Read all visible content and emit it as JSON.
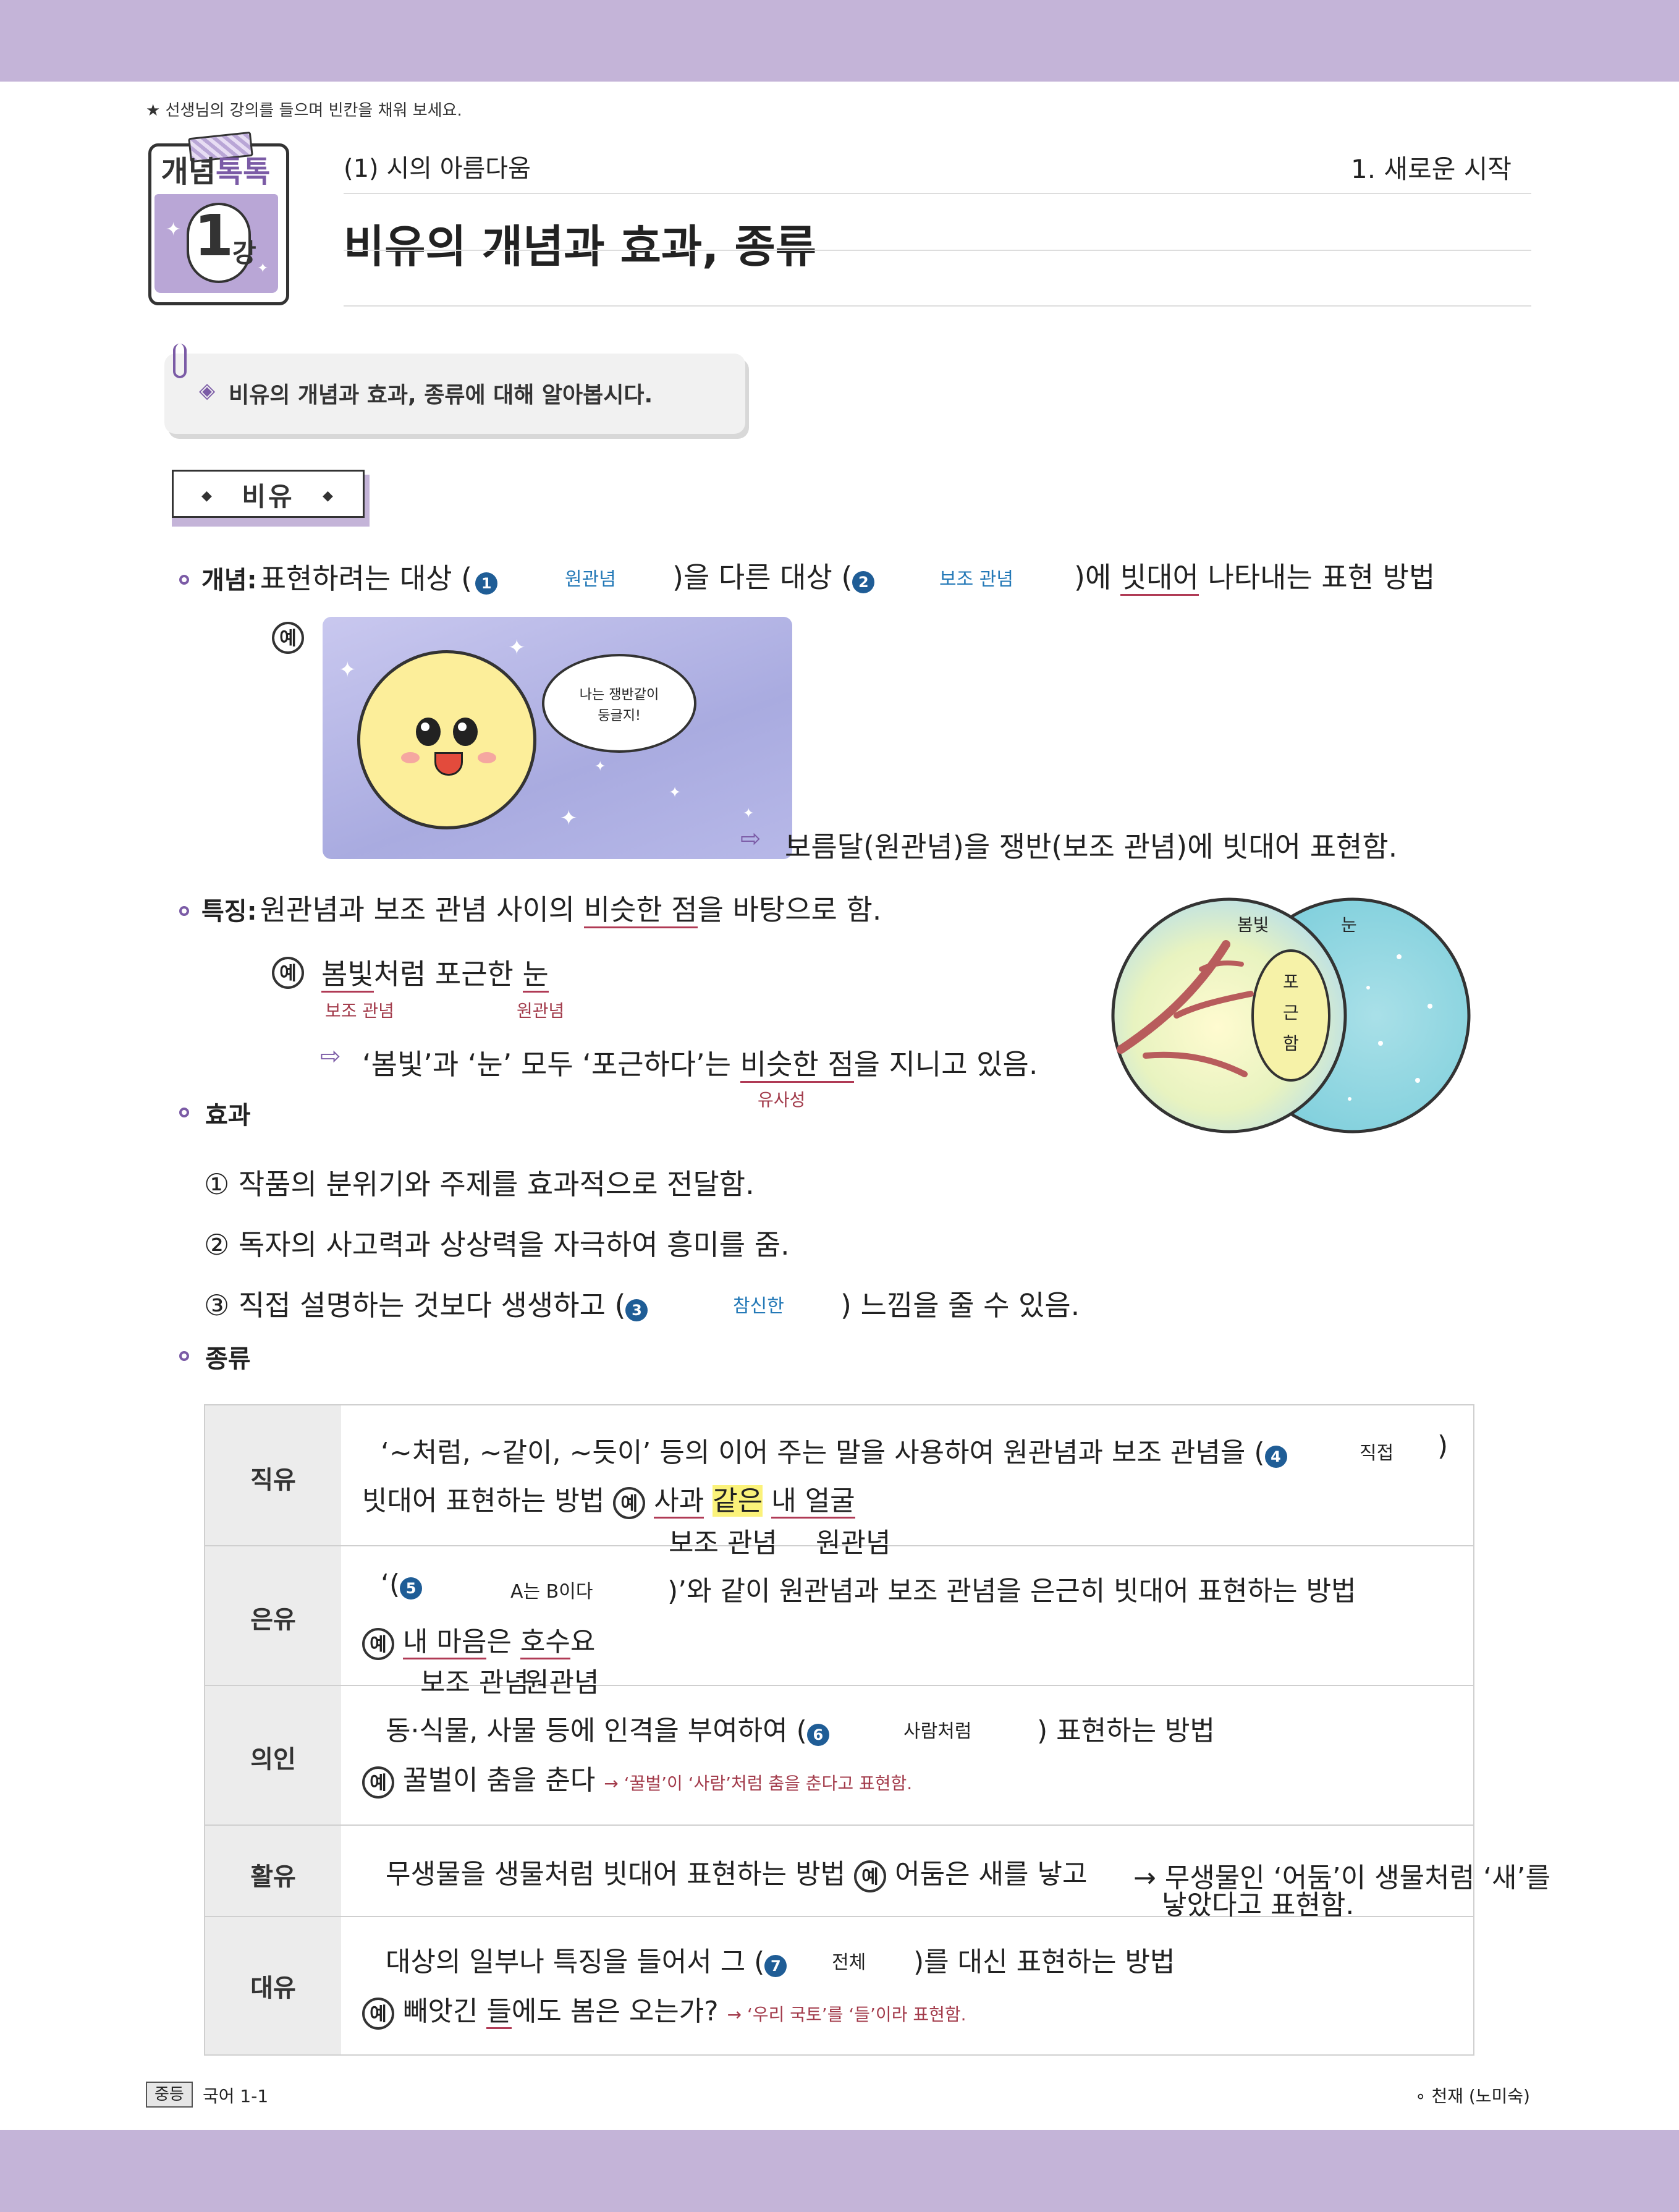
{
  "top_note": "★ 선생님의 강의를 들으며 빈칸을 채워 보세요.",
  "badge": {
    "head_a": "개념",
    "head_b": "톡톡",
    "number": "1",
    "suffix": "강"
  },
  "header": {
    "unit": "(1) 시의 아름다움",
    "chapter": "1. 새로운 시작",
    "title": "비유의 개념과 효과, 종류"
  },
  "objective": "비유의 개념과 효과, 종류에 대해 알아봅시다.",
  "section_label": "비유",
  "concept": {
    "label": "개념:",
    "t1": "표현하려는 대상 (",
    "b1": "1",
    "a1": "원관념",
    "t2": ")을 다른 대상 (",
    "b2": "2",
    "a2": "보조 관념",
    "t3": ")에 ",
    "u": "빗대어",
    "t4": " 나타내는 표현 방법",
    "ex": "예",
    "bubble_l1": "나는 쟁반같이",
    "bubble_l2": "둥글지!",
    "result": "보름달(원관념)을 쟁반(보조 관념)에 빗대어 표현함."
  },
  "feature": {
    "label": "특징:",
    "t1": "원관념과 보조 관념 사이의 ",
    "u": "비슷한 점",
    "t2": "을 바탕으로 함.",
    "ex": "예",
    "ex_u1": "봄빛",
    "ex_t": "처럼 포근한 ",
    "ex_u2": "눈",
    "note1": "보조 관념",
    "note2": "원관념",
    "r1": "‘봄빛’과 ‘눈’ 모두 ‘포근하다’는 ",
    "r_u": "비슷한 점",
    "r2": "을 지니고 있음.",
    "r_note": "유사성",
    "venn_a": "봄빛",
    "venn_b": "눈",
    "venn_mid": [
      "포",
      "근",
      "함"
    ]
  },
  "effect": {
    "label": "효과",
    "l1": "① 작품의 분위기와 주제를 효과적으로 전달함.",
    "l2": "② 독자의 사고력과 상상력을 자극하여 흥미를 줌.",
    "l3a": "③ 직접 설명하는 것보다 생생하고 (",
    "b3": "3",
    "a3": "참신한",
    "l3b": ") 느낌을 줄 수 있음."
  },
  "kinds": {
    "label": "종류",
    "ex": "예",
    "rows": [
      {
        "head": "직유",
        "t1": "‘~처럼, ~같이, ~듯이’ 등의 이어 주는 말을 사용하여 원관념과 보조 관념을 (",
        "b": "4",
        "a": "직접",
        "t1b": ")",
        "t2": "빗대어 표현하는 방법",
        "e1": "사과",
        "e2": "같은",
        "e3": "내 얼굴",
        "n1": "보조 관념",
        "n2": "원관념"
      },
      {
        "head": "은유",
        "t1": "‘(",
        "b": "5",
        "a": "A는 B이다",
        "t1b": ")’와 같이 원관념과 보조 관념을 은근히 빗대어 표현하는 방법",
        "e1": "내 마음",
        "e2": "은 ",
        "e3": "호수",
        "e4": "요",
        "n1": "보조 관념",
        "n2": "원관념"
      },
      {
        "head": "의인",
        "t1": "동·식물, 사물 등에 인격을 부여하여 (",
        "b": "6",
        "a": "사람처럼",
        "t1b": ") 표현하는 방법",
        "e1": "꿀벌이 춤을 춘다",
        "note": "→ ‘꿀벌’이 ‘사람’처럼 춤을 춘다고 표현함."
      },
      {
        "head": "활유",
        "t1": "무생물을 생물처럼 빗대어 표현하는 방법",
        "e1": "어둠은 새를 낳고",
        "note1": "→ 무생물인 ‘어둠’이 생물처럼 ‘새’를",
        "note2": "낳았다고 표현함."
      },
      {
        "head": "대유",
        "t1": "대상의 일부나 특징을 들어서 그 (",
        "b": "7",
        "a": "전체",
        "t1b": ")를 대신 표현하는 방법",
        "e1": "빼앗긴 ",
        "e2": "들",
        "e3": "에도 봄은 오는가?",
        "note": "→ ‘우리 국토’를 ‘들’이라 표현함."
      }
    ]
  },
  "footer": {
    "tag": "중등",
    "book": "국어 1-1",
    "publisher": "천재 (노미숙)"
  },
  "colors": {
    "band": "#c4b4d8",
    "accent": "#7b5ba6",
    "answer": "#2479b7",
    "note": "#a23a4a"
  }
}
